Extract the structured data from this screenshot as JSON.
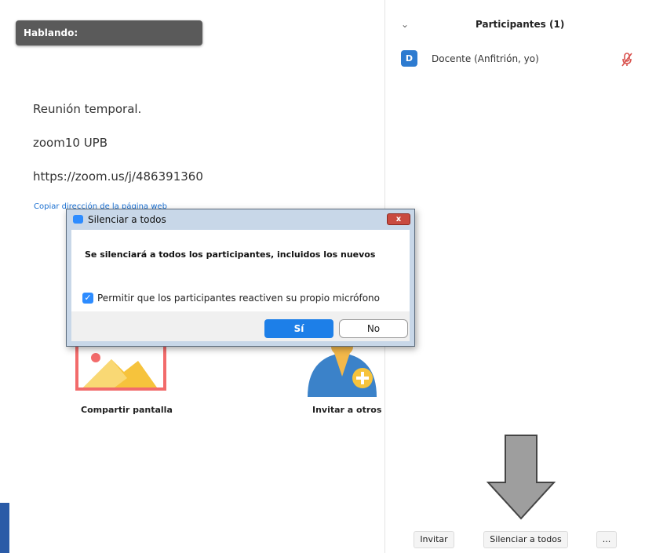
{
  "main": {
    "speaking_label": "Hablando:",
    "meeting_type": "Reunión temporal.",
    "meeting_name": "zoom10 UPB",
    "meeting_url": "https://zoom.us/j/486391360",
    "copy_link_label": "Copiar dirección de la página web",
    "share_label": "Compartir pantalla",
    "invite_label": "Invitar a otros"
  },
  "sidebar": {
    "title": "Participantes (1)",
    "participants": [
      {
        "initial": "D",
        "name": "Docente (Anfitrión, yo)",
        "mic": "mic-muted-icon"
      }
    ],
    "buttons": {
      "invite": "Invitar",
      "mute_all": "Silenciar a todos",
      "more": "..."
    }
  },
  "dialog": {
    "title": "Silenciar a todos",
    "close_label": "x",
    "message": "Se silenciará a todos los participantes, incluidos los nuevos",
    "checkbox_label": "Permitir que los participantes reactiven su propio micrófono",
    "checkbox_checked": true,
    "yes_label": "Sí",
    "no_label": "No"
  },
  "colors": {
    "accent": "#2d8cff",
    "avatar": "#2d7bd0",
    "muted_icon": "#d9534f",
    "speaking_bg": "#5a5a5a"
  }
}
